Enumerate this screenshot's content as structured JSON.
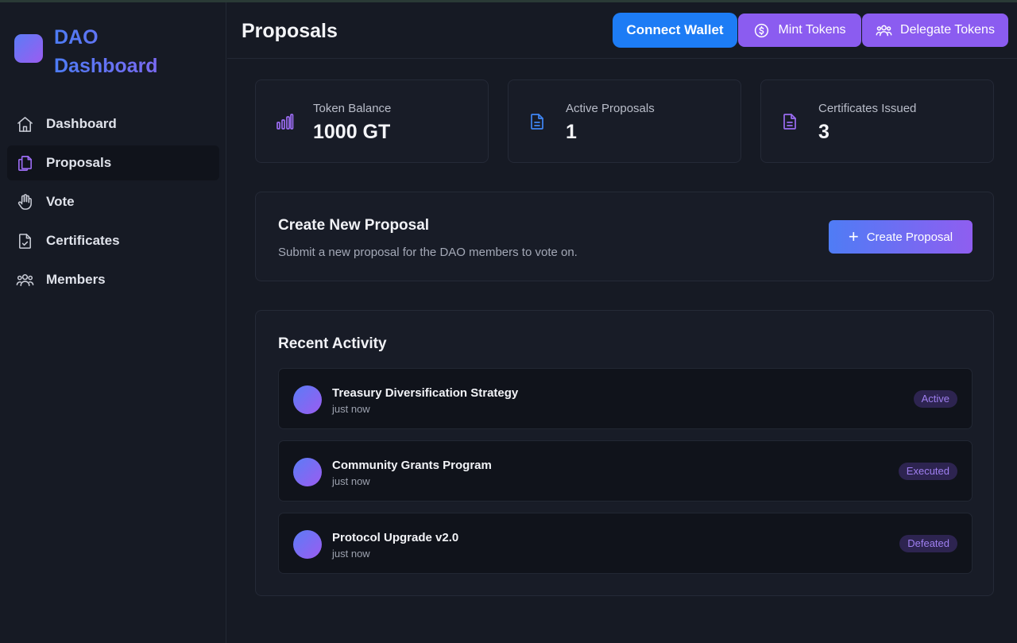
{
  "brand": {
    "title_line1": "DAO",
    "title_line2": "Dashboard"
  },
  "sidebar": {
    "items": [
      {
        "label": "Dashboard",
        "icon": "home-icon",
        "active": false
      },
      {
        "label": "Proposals",
        "icon": "files-icon",
        "active": true
      },
      {
        "label": "Vote",
        "icon": "hand-icon",
        "active": false
      },
      {
        "label": "Certificates",
        "icon": "file-check-icon",
        "active": false
      },
      {
        "label": "Members",
        "icon": "users-icon",
        "active": false
      }
    ]
  },
  "header": {
    "title": "Proposals",
    "connect_label": "Connect Wallet",
    "mint_label": "Mint Tokens",
    "delegate_label": "Delegate Tokens"
  },
  "stats": [
    {
      "label": "Token Balance",
      "value": "1000 GT",
      "icon": "bar-chart-icon"
    },
    {
      "label": "Active Proposals",
      "value": "1",
      "icon": "file-text-icon"
    },
    {
      "label": "Certificates Issued",
      "value": "3",
      "icon": "file-text-icon"
    }
  ],
  "create": {
    "title": "Create New Proposal",
    "subtitle": "Submit a new proposal for the DAO members to vote on.",
    "button_label": "Create Proposal"
  },
  "activity": {
    "title": "Recent Activity",
    "items": [
      {
        "title": "Treasury Diversification Strategy",
        "time": "just now",
        "status": "Active"
      },
      {
        "title": "Community Grants Program",
        "time": "just now",
        "status": "Executed"
      },
      {
        "title": "Protocol Upgrade v2.0",
        "time": "just now",
        "status": "Defeated"
      }
    ]
  },
  "colors": {
    "accent_blue": "#1d7cf5",
    "accent_purple": "#8b5cf0",
    "background": "#161a24",
    "card": "#181c27"
  }
}
